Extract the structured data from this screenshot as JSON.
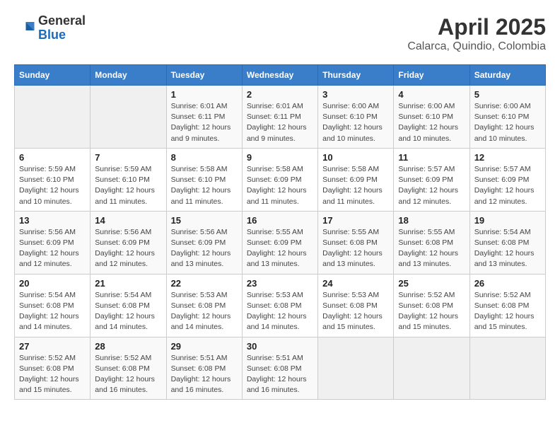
{
  "header": {
    "logo_general": "General",
    "logo_blue": "Blue",
    "title": "April 2025",
    "subtitle": "Calarca, Quindio, Colombia"
  },
  "weekdays": [
    "Sunday",
    "Monday",
    "Tuesday",
    "Wednesday",
    "Thursday",
    "Friday",
    "Saturday"
  ],
  "weeks": [
    [
      {
        "day": "",
        "empty": true
      },
      {
        "day": "",
        "empty": true
      },
      {
        "day": "1",
        "sunrise": "6:01 AM",
        "sunset": "6:11 PM",
        "daylight": "12 hours and 9 minutes."
      },
      {
        "day": "2",
        "sunrise": "6:01 AM",
        "sunset": "6:11 PM",
        "daylight": "12 hours and 9 minutes."
      },
      {
        "day": "3",
        "sunrise": "6:00 AM",
        "sunset": "6:10 PM",
        "daylight": "12 hours and 10 minutes."
      },
      {
        "day": "4",
        "sunrise": "6:00 AM",
        "sunset": "6:10 PM",
        "daylight": "12 hours and 10 minutes."
      },
      {
        "day": "5",
        "sunrise": "6:00 AM",
        "sunset": "6:10 PM",
        "daylight": "12 hours and 10 minutes."
      }
    ],
    [
      {
        "day": "6",
        "sunrise": "5:59 AM",
        "sunset": "6:10 PM",
        "daylight": "12 hours and 10 minutes."
      },
      {
        "day": "7",
        "sunrise": "5:59 AM",
        "sunset": "6:10 PM",
        "daylight": "12 hours and 11 minutes."
      },
      {
        "day": "8",
        "sunrise": "5:58 AM",
        "sunset": "6:10 PM",
        "daylight": "12 hours and 11 minutes."
      },
      {
        "day": "9",
        "sunrise": "5:58 AM",
        "sunset": "6:09 PM",
        "daylight": "12 hours and 11 minutes."
      },
      {
        "day": "10",
        "sunrise": "5:58 AM",
        "sunset": "6:09 PM",
        "daylight": "12 hours and 11 minutes."
      },
      {
        "day": "11",
        "sunrise": "5:57 AM",
        "sunset": "6:09 PM",
        "daylight": "12 hours and 12 minutes."
      },
      {
        "day": "12",
        "sunrise": "5:57 AM",
        "sunset": "6:09 PM",
        "daylight": "12 hours and 12 minutes."
      }
    ],
    [
      {
        "day": "13",
        "sunrise": "5:56 AM",
        "sunset": "6:09 PM",
        "daylight": "12 hours and 12 minutes."
      },
      {
        "day": "14",
        "sunrise": "5:56 AM",
        "sunset": "6:09 PM",
        "daylight": "12 hours and 12 minutes."
      },
      {
        "day": "15",
        "sunrise": "5:56 AM",
        "sunset": "6:09 PM",
        "daylight": "12 hours and 13 minutes."
      },
      {
        "day": "16",
        "sunrise": "5:55 AM",
        "sunset": "6:09 PM",
        "daylight": "12 hours and 13 minutes."
      },
      {
        "day": "17",
        "sunrise": "5:55 AM",
        "sunset": "6:08 PM",
        "daylight": "12 hours and 13 minutes."
      },
      {
        "day": "18",
        "sunrise": "5:55 AM",
        "sunset": "6:08 PM",
        "daylight": "12 hours and 13 minutes."
      },
      {
        "day": "19",
        "sunrise": "5:54 AM",
        "sunset": "6:08 PM",
        "daylight": "12 hours and 13 minutes."
      }
    ],
    [
      {
        "day": "20",
        "sunrise": "5:54 AM",
        "sunset": "6:08 PM",
        "daylight": "12 hours and 14 minutes."
      },
      {
        "day": "21",
        "sunrise": "5:54 AM",
        "sunset": "6:08 PM",
        "daylight": "12 hours and 14 minutes."
      },
      {
        "day": "22",
        "sunrise": "5:53 AM",
        "sunset": "6:08 PM",
        "daylight": "12 hours and 14 minutes."
      },
      {
        "day": "23",
        "sunrise": "5:53 AM",
        "sunset": "6:08 PM",
        "daylight": "12 hours and 14 minutes."
      },
      {
        "day": "24",
        "sunrise": "5:53 AM",
        "sunset": "6:08 PM",
        "daylight": "12 hours and 15 minutes."
      },
      {
        "day": "25",
        "sunrise": "5:52 AM",
        "sunset": "6:08 PM",
        "daylight": "12 hours and 15 minutes."
      },
      {
        "day": "26",
        "sunrise": "5:52 AM",
        "sunset": "6:08 PM",
        "daylight": "12 hours and 15 minutes."
      }
    ],
    [
      {
        "day": "27",
        "sunrise": "5:52 AM",
        "sunset": "6:08 PM",
        "daylight": "12 hours and 15 minutes."
      },
      {
        "day": "28",
        "sunrise": "5:52 AM",
        "sunset": "6:08 PM",
        "daylight": "12 hours and 16 minutes."
      },
      {
        "day": "29",
        "sunrise": "5:51 AM",
        "sunset": "6:08 PM",
        "daylight": "12 hours and 16 minutes."
      },
      {
        "day": "30",
        "sunrise": "5:51 AM",
        "sunset": "6:08 PM",
        "daylight": "12 hours and 16 minutes."
      },
      {
        "day": "",
        "empty": true
      },
      {
        "day": "",
        "empty": true
      },
      {
        "day": "",
        "empty": true
      }
    ]
  ]
}
